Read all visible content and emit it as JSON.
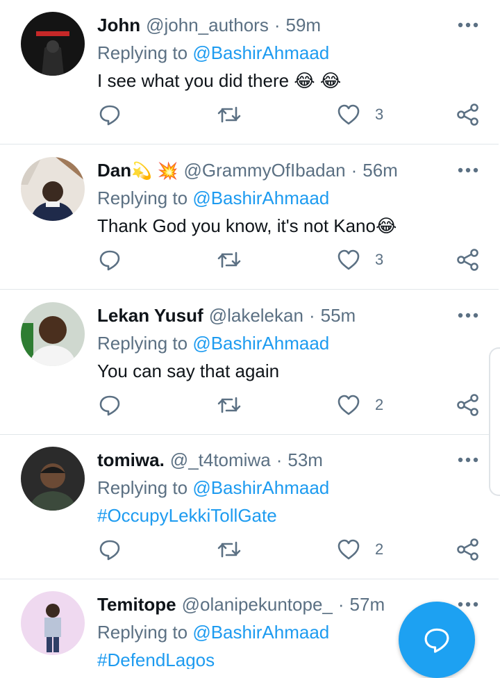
{
  "colors": {
    "accent": "#1d9bf0",
    "muted": "#5b7083",
    "text": "#0f1419",
    "divider": "#e1e6ea",
    "fab": "#1da1f2"
  },
  "icons": [
    "more-icon",
    "reply-icon",
    "retweet-icon",
    "like-icon",
    "share-icon",
    "compose-reply-icon"
  ],
  "tweets": [
    {
      "name": "John",
      "name_emoji": "",
      "handle": "@john_authors",
      "separator": "·",
      "time": "59m",
      "replying_prefix": "Replying to ",
      "replying_to": "@BashirAhmaad",
      "text": "I see what you did there 😂 😂",
      "likes": "3"
    },
    {
      "name": "Dan",
      "name_emoji": "💫 💥",
      "handle": "@GrammyOfIbadan",
      "separator": "·",
      "time": "56m",
      "replying_prefix": "Replying to ",
      "replying_to": "@BashirAhmaad",
      "text": "Thank God you know, it's not Kano😂",
      "likes": "3"
    },
    {
      "name": "Lekan Yusuf",
      "name_emoji": "",
      "handle": "@lakelekan",
      "separator": "·",
      "time": "55m",
      "replying_prefix": "Replying to ",
      "replying_to": "@BashirAhmaad",
      "text": "You can say that again",
      "likes": "2"
    },
    {
      "name": "tomiwa.",
      "name_emoji": "",
      "handle": "@_t4tomiwa",
      "separator": "·",
      "time": "53m",
      "replying_prefix": "Replying to ",
      "replying_to": "@BashirAhmaad",
      "text": "#OccupyLekkiTollGate",
      "likes": "2"
    },
    {
      "name": "Temitope",
      "name_emoji": "",
      "handle": "@olanipekuntope_",
      "separator": "·",
      "time": "57m",
      "replying_prefix": "Replying to ",
      "replying_to": "@BashirAhmaad",
      "text": "#DefendLagos",
      "likes": ""
    }
  ]
}
